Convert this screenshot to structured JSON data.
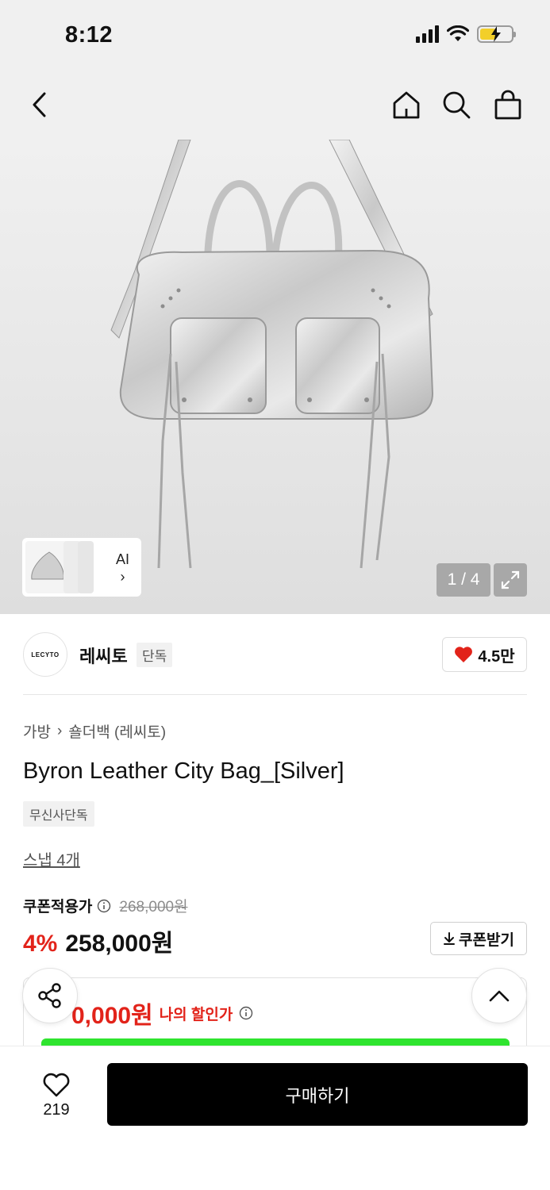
{
  "status_bar": {
    "time": "8:12"
  },
  "nav": {
    "back_icon": "chevron-left-icon",
    "home_icon": "home-icon",
    "search_icon": "search-icon",
    "cart_icon": "shopping-bag-icon"
  },
  "hero": {
    "page_counter": "1 / 4",
    "ai_label": "AI",
    "ai_chevron": "›"
  },
  "brand": {
    "logo_text": "LECYTO",
    "name": "레씨토",
    "exclusive_tag": "단독",
    "likes": "4.5만"
  },
  "product": {
    "breadcrumb": [
      "가방",
      "숄더백 (레씨토)"
    ],
    "breadcrumb_sep": "›",
    "title": "Byron Leather City Bag_[Silver]",
    "store_tag": "무신사단독",
    "snap_link": "스냅 4개",
    "coupon_label": "쿠폰적용가",
    "original_price": "268,000원",
    "discount_rate": "4%",
    "sale_price": "258,000원",
    "coupon_button": "쿠폰받기",
    "my_price": "0,000원",
    "my_price_label": "나의 할인가"
  },
  "bottom_bar": {
    "wish_count": "219",
    "buy_button": "구매하기"
  },
  "colors": {
    "accent_red": "#e2231a",
    "green_bar": "#2fe42f",
    "battery": "#f2cf2a"
  }
}
